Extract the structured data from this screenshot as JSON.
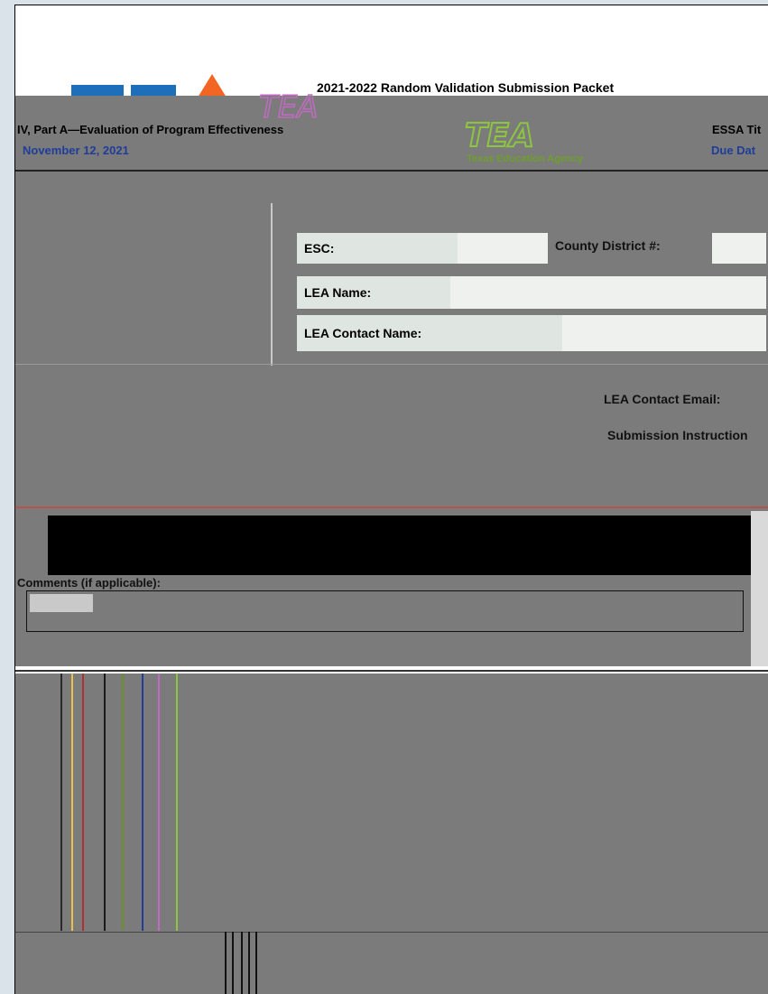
{
  "header": {
    "packet_title": "2021-2022 Random Validation Submission Packet",
    "program_title": "IV, Part A—Evaluation of Program Effectiveness",
    "due_date": "November 12, 2021",
    "essa_title_fragment": "ESSA Tit",
    "due_date_label_fragment": "Due Dat"
  },
  "logo": {
    "wordmark": "TEA",
    "agency_name": "Texas Education Agency"
  },
  "form": {
    "esc_label": "ESC:",
    "county_district_label": "County District #:",
    "lea_name_label": "LEA Name:",
    "lea_contact_name_label": "LEA Contact Name:",
    "lea_contact_email_label": "LEA Contact Email:",
    "submission_instructions_label": "Submission Instruction",
    "comments_label": "Comments (if applicable):"
  },
  "colors": {
    "band_gray": "#7b7b7b",
    "accent_blue": "#1f3d99",
    "tea_green": "#8cc63f",
    "logo_blue": "#1e6fba",
    "logo_orange": "#f26522",
    "due_date_red": "#e03a2a",
    "label_cell": "#dfe6e1"
  }
}
